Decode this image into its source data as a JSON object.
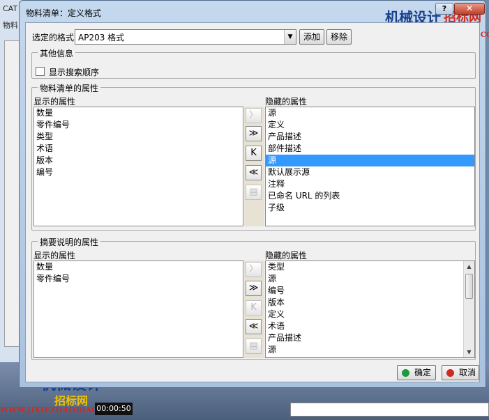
{
  "background": {
    "app_title": "CAT",
    "app_sub": "物料",
    "timecode": "00:00:50",
    "watermark": {
      "brand": "机械设计",
      "brand2": "招标网",
      "url": "WWW.JIXIEZHAOBIAO.COM"
    }
  },
  "dialog": {
    "title": "物料清单：定义格式",
    "help_label": "?",
    "close_label": "✕",
    "format": {
      "label": "选定的格式",
      "value": "AP203 格式",
      "add_label": "添加",
      "remove_label": "移除"
    },
    "other_info": {
      "legend": "其他信息",
      "show_search_order": "显示搜索顺序"
    },
    "bom_attributes": {
      "legend": "物料清单的属性",
      "shown_label": "显示的属性",
      "hidden_label": "隐藏的属性",
      "shown": [
        "数量",
        "零件编号",
        "类型",
        "术语",
        "版本",
        "编号"
      ],
      "hidden": [
        "源",
        "定义",
        "产品描述",
        "部件描述",
        "源",
        "默认展示源",
        "注释",
        "已命名 URL 的列表",
        "子级"
      ],
      "selected_hidden_index": 4
    },
    "summary_attributes": {
      "legend": "摘要说明的属性",
      "shown_label": "显示的属性",
      "hidden_label": "隐藏的属性",
      "shown": [
        "数量",
        "零件编号"
      ],
      "hidden": [
        "类型",
        "源",
        "编号",
        "版本",
        "定义",
        "术语",
        "产品描述",
        "源"
      ]
    },
    "tools": {
      "move_one_right": "〉",
      "move_all_right": "≫",
      "move_one_left": "K",
      "move_all_left": "≪"
    },
    "ok_label": "确定",
    "cancel_label": "取消"
  },
  "colors": {
    "selection": "#3399ff",
    "ok_dot": "#1f9a3a",
    "cancel_dot": "#d02a1e",
    "title_gradient_top": "#c4d8ee"
  }
}
